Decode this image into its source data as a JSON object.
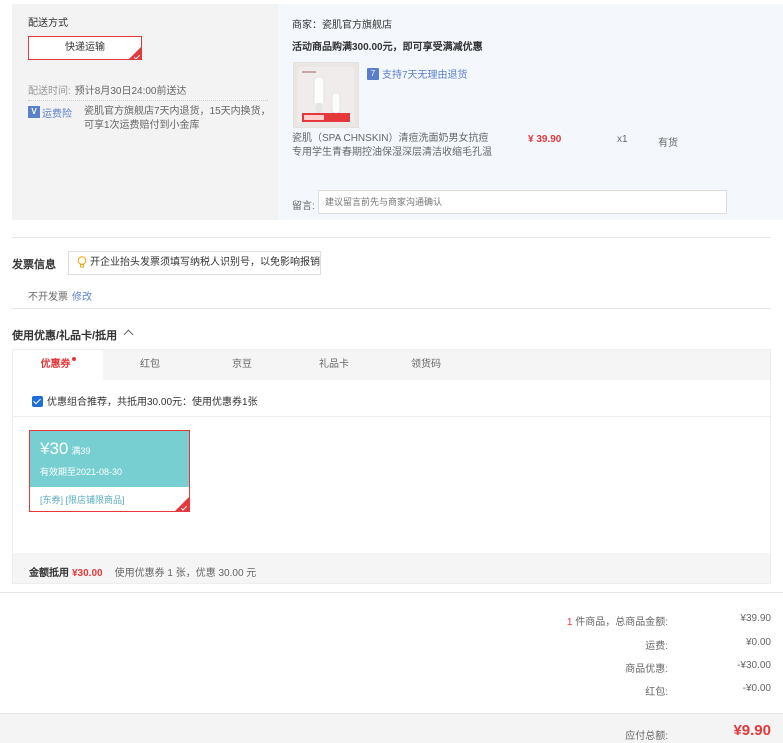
{
  "shipping": {
    "title": "配送方式",
    "method": "快递运输",
    "time_label": "配送时间:",
    "time_value": "预计8月30日24:00前送达",
    "insurance_icon": "V",
    "insurance_label": "运费险",
    "insurance_desc": "瓷肌官方旗舰店7天内退货，15天内换货，可享1次运费赔付到小金库"
  },
  "merchant": {
    "name": "商家：瓷肌官方旗舰店",
    "promo": "活动商品购满300.00元，即可享受满减优惠",
    "return_icon": "7",
    "return_policy": "支持7天无理由退货",
    "product": {
      "name": "瓷肌（SPA CHNSKIN）清痘洗面奶男女抗痘专用学生青春期控油保湿深层清洁收缩毛孔温",
      "price": "¥ 39.90",
      "qty": "x1",
      "stock": "有货"
    },
    "remark_label": "留言:",
    "remark_placeholder": "建议留言前先与商家沟通确认"
  },
  "invoice": {
    "title": "发票信息",
    "tip": "开企业抬头发票须填写纳税人识别号，以免影响报销",
    "status": "不开发票",
    "edit": "修改"
  },
  "coupons": {
    "title": "使用优惠/礼品卡/抵用",
    "tabs": [
      {
        "label": "优惠券"
      },
      {
        "label": "红包"
      },
      {
        "label": "京豆"
      },
      {
        "label": "礼品卡"
      },
      {
        "label": "领货码"
      }
    ],
    "recommend": "优惠组合推荐，共抵用30.00元：使用优惠券1张",
    "card": {
      "amount": "¥30",
      "threshold": "满39",
      "expiry": "有效期至2021-08-30",
      "tags": "[东券] [限店铺限商品]"
    },
    "summary_label": "金额抵用",
    "summary_amount": "¥30.00",
    "summary_used": "使用优惠券 1 张，优惠 30.00 元"
  },
  "totals": {
    "item_count": "1",
    "item_label": "件商品，总商品金额:",
    "item_value": "¥39.90",
    "shipping_label": "运费:",
    "shipping_value": "¥0.00",
    "discount_label": "商品优惠:",
    "discount_value": "-¥30.00",
    "redpacket_label": "红包:",
    "redpacket_value": "-¥0.00",
    "payable_label": "应付总额:",
    "payable_value": "¥9.90"
  },
  "colors": {
    "accent": "#e4393c",
    "link": "#5b7fc9",
    "coupon": "#77cfd2"
  }
}
